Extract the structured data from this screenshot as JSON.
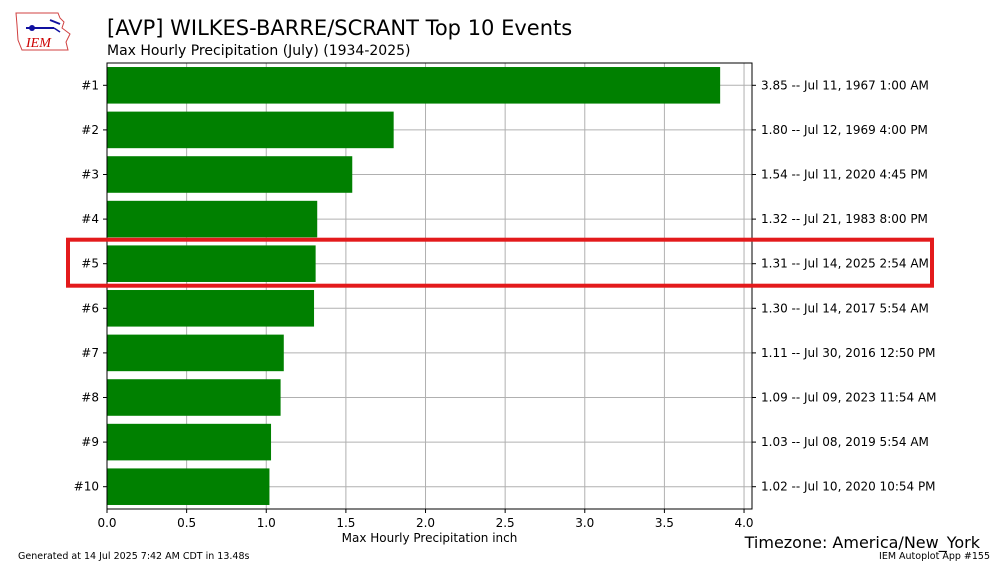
{
  "header": {
    "logo_text": "IEM",
    "title": "[AVP] WILKES-BARRE/SCRANT Top 10 Events",
    "subtitle": "Max Hourly Precipitation  (July) (1934-2025)"
  },
  "footer": {
    "generated": "Generated at 14 Jul 2025 7:42 AM CDT in 13.48s",
    "app": "IEM Autoplot App #155",
    "timezone": "Timezone: America/New_York"
  },
  "colors": {
    "bar": "#008000",
    "highlight": "#e31a1c",
    "grid": "#b0b0b0"
  },
  "chart_data": {
    "type": "bar",
    "orientation": "horizontal",
    "xlabel": "Max Hourly Precipitation inch",
    "xlim": [
      0,
      4.05
    ],
    "xticks": [
      "0.0",
      "0.5",
      "1.0",
      "1.5",
      "2.0",
      "2.5",
      "3.0",
      "3.5",
      "4.0"
    ],
    "grid": true,
    "categories": [
      "#1",
      "#2",
      "#3",
      "#4",
      "#5",
      "#6",
      "#7",
      "#8",
      "#9",
      "#10"
    ],
    "values": [
      3.85,
      1.8,
      1.54,
      1.32,
      1.31,
      1.3,
      1.11,
      1.09,
      1.03,
      1.02
    ],
    "right_labels": [
      "3.85 -- Jul 11, 1967 1:00 AM",
      "1.80 -- Jul 12, 1969 4:00 PM",
      "1.54 -- Jul 11, 2020 4:45 PM",
      "1.32 -- Jul 21, 1983 8:00 PM",
      "1.31 -- Jul 14, 2025 2:54 AM",
      "1.30 -- Jul 14, 2017 5:54 AM",
      "1.11 -- Jul 30, 2016 12:50 PM",
      "1.09 -- Jul 09, 2023 11:54 AM",
      "1.03 -- Jul 08, 2019 5:54 AM",
      "1.02 -- Jul 10, 2020 10:54 PM"
    ],
    "highlighted_rank": "#5"
  }
}
